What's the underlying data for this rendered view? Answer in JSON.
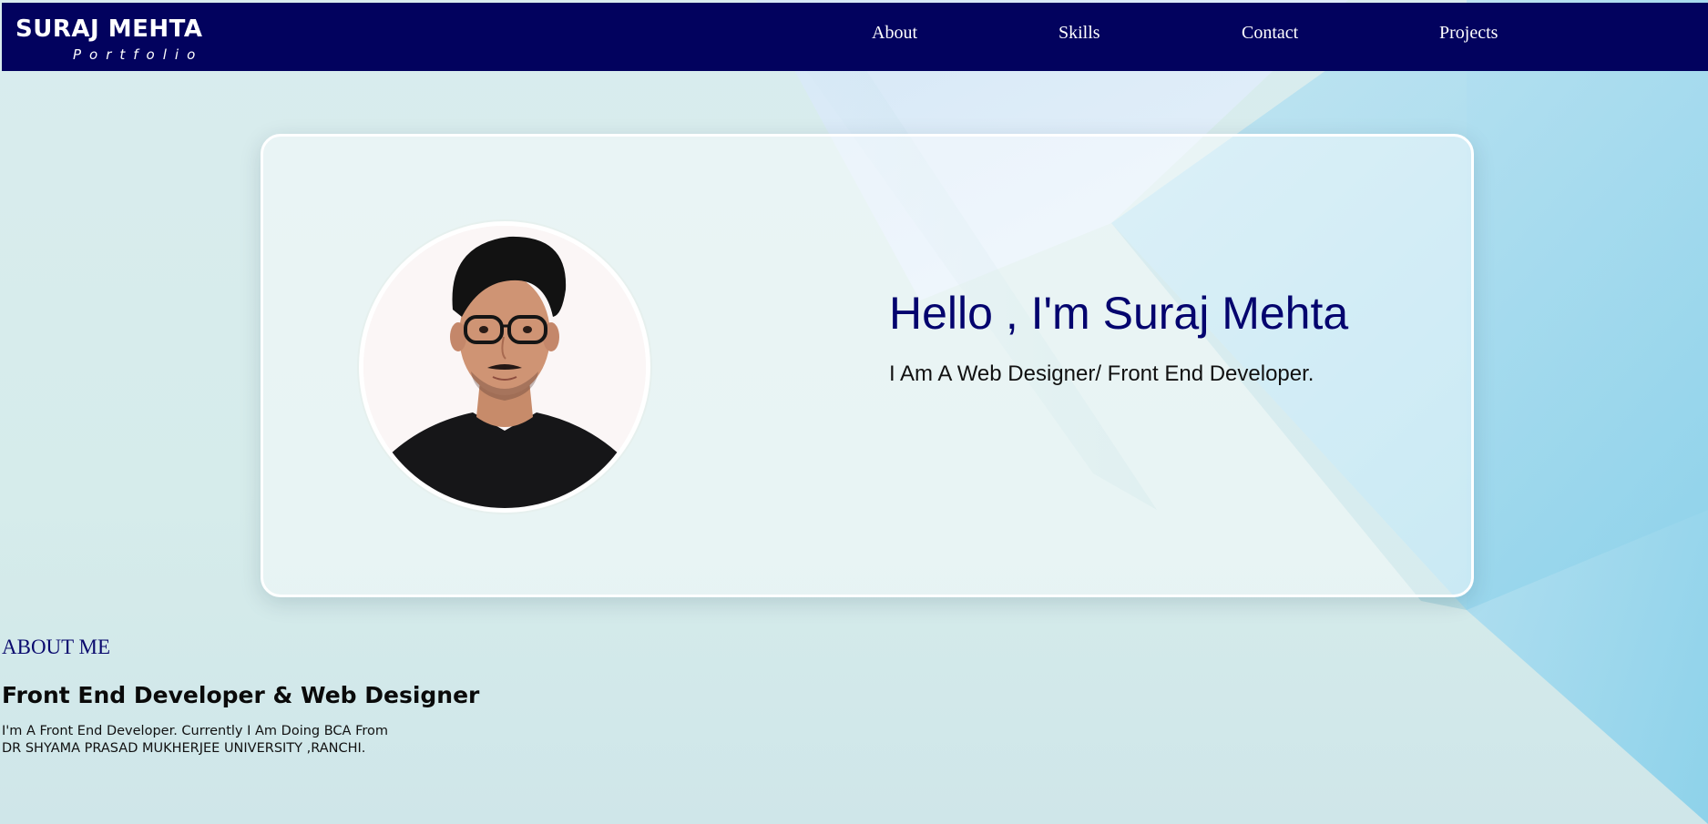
{
  "header": {
    "brand_title": "SURAJ MEHTA",
    "brand_subtitle": "Portfolio",
    "nav": [
      {
        "label": "About"
      },
      {
        "label": "Skills"
      },
      {
        "label": "Contact"
      },
      {
        "label": "Projects"
      }
    ]
  },
  "hero": {
    "title": "Hello , I'm Suraj Mehta",
    "subtitle": "I Am A Web Designer/ Front End Developer.",
    "avatar_icon": "profile-photo"
  },
  "about": {
    "heading": "ABOUT ME",
    "title": "Front End Developer & Web Designer",
    "line1": "I'm A Front End Developer. Currently I Am Doing BCA From",
    "line2": "DR SHYAMA PRASAD MUKHERJEE UNIVERSITY ,RANCHI."
  },
  "colors": {
    "navbar": "#02025e",
    "accent_text": "#04046e",
    "background": "#d9ecee",
    "paper_blue": "#8fd3ea"
  }
}
